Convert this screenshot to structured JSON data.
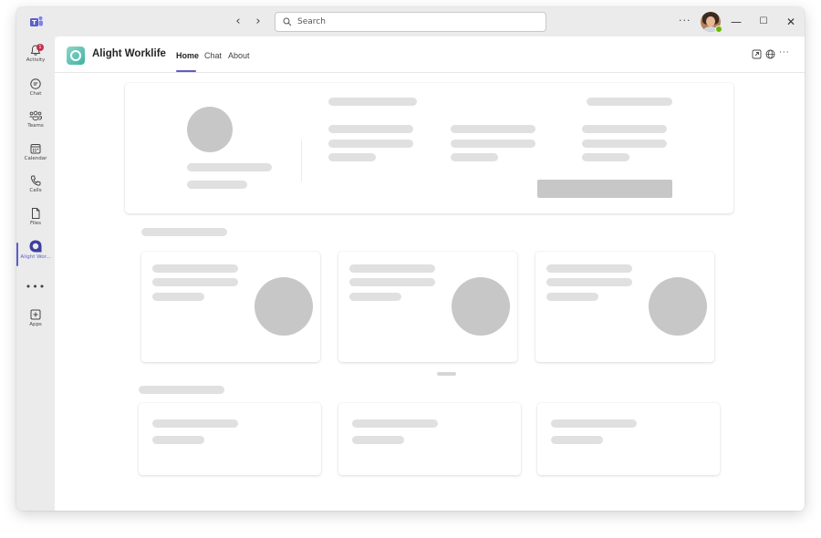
{
  "titlebar": {
    "search_placeholder": "Search",
    "more_label": "···",
    "minimize_label": "—",
    "maximize_label": "☐",
    "close_label": "✕",
    "back_label": "‹",
    "forward_label": "›"
  },
  "rail": {
    "items": [
      {
        "label": "Activity",
        "icon": "bell-icon"
      },
      {
        "label": "Chat",
        "icon": "chat-icon"
      },
      {
        "label": "Teams",
        "icon": "teams-icon"
      },
      {
        "label": "Calendar",
        "icon": "calendar-icon"
      },
      {
        "label": "Calls",
        "icon": "phone-icon"
      },
      {
        "label": "Files",
        "icon": "file-icon"
      },
      {
        "label": "Alight Wor...",
        "icon": "alight-icon"
      },
      {
        "label": "Apps",
        "icon": "plus-square-icon"
      }
    ],
    "more_label": "•••",
    "activity_badge": "1"
  },
  "app": {
    "name": "Alight Worklife",
    "tabs": [
      "Home",
      "Chat",
      "About"
    ],
    "active_tab": "Home",
    "more_label": "···"
  },
  "colors": {
    "accent": "#5b5fc7",
    "skeleton_light": "#e0e0e0",
    "skeleton_dark": "#c7c7c7",
    "presence": "#6bb700",
    "badge": "#c4314b"
  },
  "state": "loading-skeleton"
}
